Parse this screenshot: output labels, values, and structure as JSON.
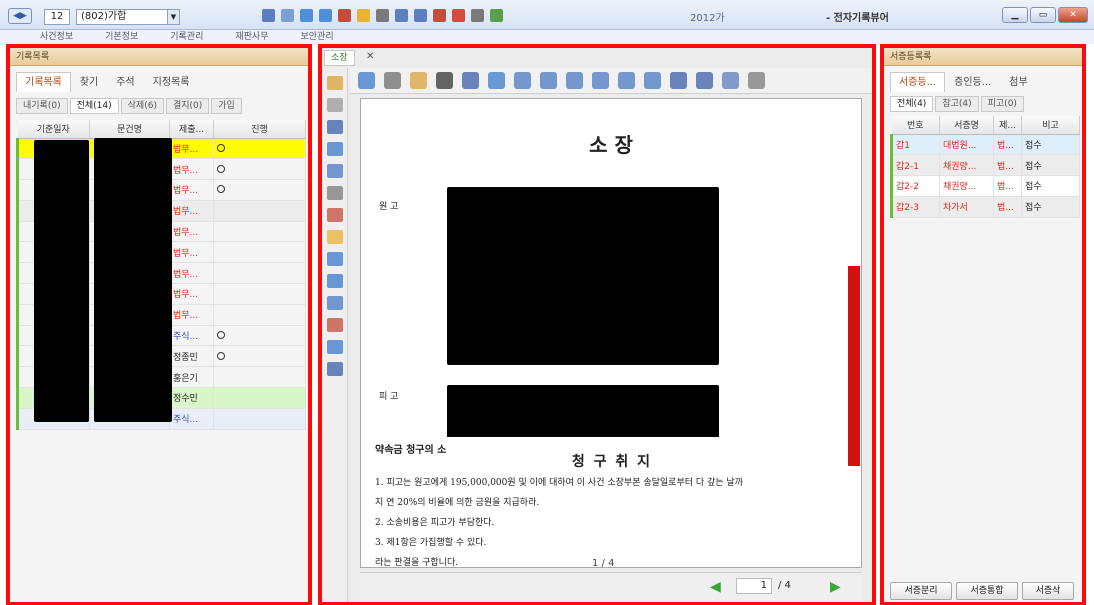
{
  "titlebar": {
    "number": "12",
    "case_select": "(802)가합",
    "year": "2012가",
    "app_title": "- 전자기록뷰어",
    "tool_icon_colors": [
      "#5b7fbf",
      "#7ba0d8",
      "#4f8fd6",
      "#4f8fd6",
      "#c24e3a",
      "#e9b233",
      "#7a7a7a",
      "#5b7fbf",
      "#5b7fbf",
      "#c24e3a",
      "#d24b3f",
      "#7a7a7a",
      "#5aa04a"
    ]
  },
  "menubar": [
    "사건정보",
    "기본정보",
    "기록관리",
    "재판사무",
    "보안관리"
  ],
  "left": {
    "header": "기록목록",
    "tabs": [
      "기록목록",
      "찾기",
      "주석",
      "지정목록"
    ],
    "subtabs": [
      "내기록(0)",
      "전체(14)",
      "삭제(6)",
      "결지(0)",
      "가입"
    ],
    "columns": [
      "기준일자",
      "문건명",
      "제출...",
      "진행"
    ],
    "rows": [
      {
        "submitter": "법무...",
        "color": "red",
        "circle": true,
        "style": "yellow"
      },
      {
        "submitter": "법무...",
        "color": "red",
        "circle": true,
        "style": "white"
      },
      {
        "submitter": "법무...",
        "color": "red",
        "circle": true,
        "style": "white"
      },
      {
        "submitter": "법무...",
        "color": "red",
        "circle": false,
        "style": "grey"
      },
      {
        "submitter": "법무...",
        "color": "red",
        "circle": false,
        "style": "white"
      },
      {
        "submitter": "법무...",
        "color": "red",
        "circle": false,
        "style": "white"
      },
      {
        "submitter": "법무...",
        "color": "red",
        "circle": false,
        "style": "white"
      },
      {
        "submitter": "법무...",
        "color": "red",
        "circle": false,
        "style": "white"
      },
      {
        "submitter": "법무...",
        "color": "red",
        "circle": false,
        "style": "white"
      },
      {
        "submitter": "주식...",
        "color": "blue",
        "circle": true,
        "style": "white"
      },
      {
        "submitter": "정종민",
        "color": "dark",
        "circle": true,
        "style": "white"
      },
      {
        "submitter": "홍은기",
        "color": "dark",
        "circle": false,
        "style": "white"
      },
      {
        "submitter": "정수민",
        "color": "dark",
        "circle": false,
        "style": "green"
      },
      {
        "submitter": "주식...",
        "color": "blue",
        "circle": false,
        "style": "blueish"
      }
    ]
  },
  "center": {
    "tab": "소장",
    "tab_close": "✕",
    "doc_title": "소   장",
    "plaintiff_label": "원   고",
    "defendant_label": "피   고",
    "case_caption": "약속금 청구의 소",
    "claim_heading": "청 구 취 지",
    "claim_lines": [
      "1. 피고는 원고에게 195,000,000원 및 이에 대하여 이 사건 소장부본 송달일로부터 다 갚는 날까",
      "지 연 20%의 비율에 의한 금원을 지급하라.",
      "2. 소송비용은 피고가 부담한다.",
      "3. 제1항은 가집행할 수 있다.",
      "라는 판결을 구합니다."
    ],
    "page_indicator": "1 / 4",
    "page_current": "1",
    "page_total": "/ 4",
    "htool_colors": [
      "#3b79c9",
      "#6e6e6e",
      "#d9a13a",
      "#333333",
      "#3b5fa8",
      "#3b79c9",
      "#4a7ac0",
      "#4a7ac0",
      "#4a7ac0",
      "#4a7ac0",
      "#4a7ac0",
      "#4a7ac0",
      "#3b5fa8",
      "#3b5fa8",
      "#5b7fbf",
      "#7a7a7a"
    ],
    "vtool_colors": [
      "#d9a13a",
      "#999999",
      "#3b5fa8",
      "#3b79c9",
      "#4a7ac0",
      "#7a7a7a",
      "#c24e3a",
      "#e9b233",
      "#3b79c9",
      "#3b79c9",
      "#4a7ac0",
      "#c24e3a",
      "#3b79c9",
      "#3b5fa8"
    ]
  },
  "right": {
    "header": "서증등록록",
    "tabs": [
      "서증등...",
      "증인등...",
      "첨부"
    ],
    "subtabs": [
      "전체(4)",
      "참고(4)",
      "피고(0)"
    ],
    "columns": [
      "번호",
      "서증명",
      "제...",
      "비고"
    ],
    "rows": [
      {
        "no": "갑1",
        "name": "대법원...",
        "sub": "법...",
        "note": "접수",
        "style": "blue"
      },
      {
        "no": "갑2-1",
        "name": "채권양...",
        "sub": "법...",
        "note": "접수",
        "style": "grey"
      },
      {
        "no": "갑2-2",
        "name": "채권양...",
        "sub": "법...",
        "note": "접수",
        "style": "white"
      },
      {
        "no": "갑2-3",
        "name": "차가서",
        "sub": "법...",
        "note": "접수",
        "style": "grey"
      }
    ],
    "buttons": [
      "서증분리",
      "서증통합",
      "서증삭"
    ]
  }
}
